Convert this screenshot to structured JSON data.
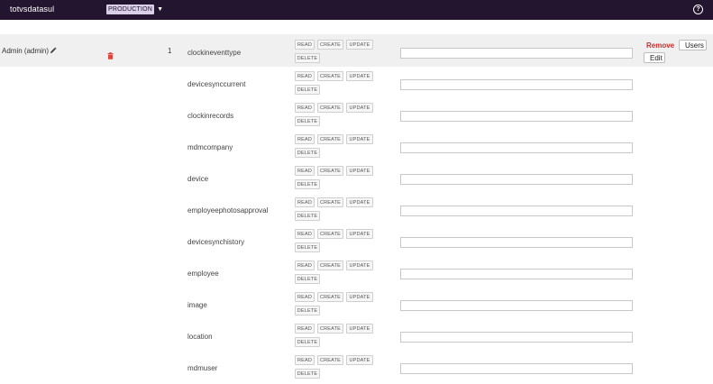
{
  "topbar": {
    "app_name": "totvsdatasul",
    "environment": "PRODUCTION",
    "help_glyph": "?"
  },
  "user": {
    "label": "Admin (admin)",
    "count": "1"
  },
  "actions": {
    "remove": "Remove",
    "users": "Users",
    "edit": "Edit"
  },
  "permission_labels": {
    "read": "READ",
    "create": "CREATE",
    "update": "UPDATE",
    "delete": "DELETE"
  },
  "entities": [
    {
      "name": "clockineventtype"
    },
    {
      "name": "devicesynccurrent"
    },
    {
      "name": "clockinrecords"
    },
    {
      "name": "mdmcompany"
    },
    {
      "name": "device"
    },
    {
      "name": "employeephotosapproval"
    },
    {
      "name": "devicesynchistory"
    },
    {
      "name": "employee"
    },
    {
      "name": "image"
    },
    {
      "name": "location"
    },
    {
      "name": "mdmuser"
    }
  ],
  "colors": {
    "topbar": "#23142f",
    "badge": "#d9cfe8",
    "remove": "#cc2e2e",
    "trash": "#e0443a"
  },
  "icons": [
    "help-icon",
    "pencil-icon",
    "trash-icon",
    "chevron-down-icon"
  ]
}
